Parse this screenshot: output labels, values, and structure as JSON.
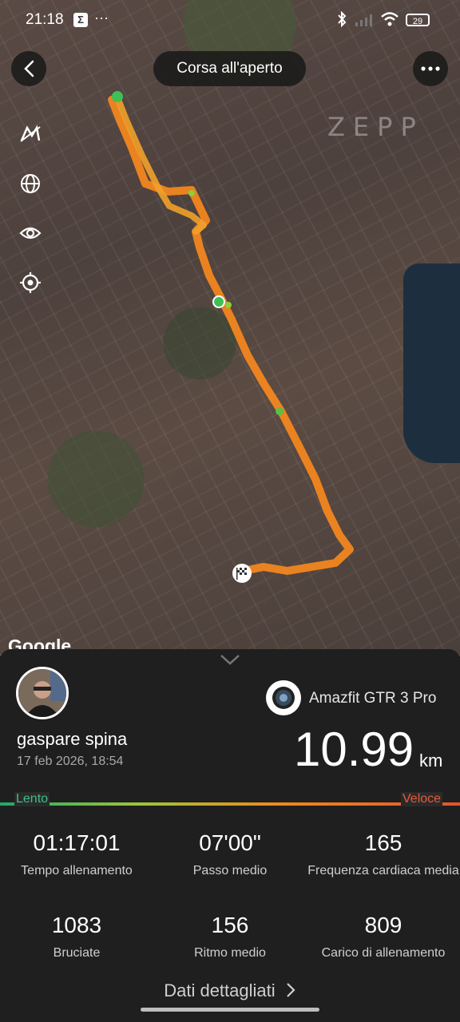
{
  "status_bar": {
    "time": "21:18",
    "sigma": "Σ",
    "more": "···",
    "battery": "29"
  },
  "header": {
    "title": "Corsa all'aperto"
  },
  "map": {
    "brand": "ZEPP",
    "attribution": "Google"
  },
  "profile": {
    "name": "gaspare spina",
    "date": "17 feb 2026, 18:54"
  },
  "device": {
    "name": "Amazfit GTR 3 Pro"
  },
  "summary": {
    "distance": "10.99",
    "unit": "km"
  },
  "pace_scale": {
    "slow_label": "Lento",
    "fast_label": "Veloce"
  },
  "stats": [
    {
      "value": "01:17:01",
      "label": "Tempo allenamento"
    },
    {
      "value": "07'00\"",
      "label": "Passo medio"
    },
    {
      "value": "165",
      "label": "Frequenza cardiaca media"
    },
    {
      "value": "1083",
      "label": "Bruciate"
    },
    {
      "value": "156",
      "label": "Ritmo medio"
    },
    {
      "value": "809",
      "label": "Carico di allenamento"
    }
  ],
  "footer": {
    "details_label": "Dati dettagliati"
  },
  "colors": {
    "route": "#f2861f",
    "slow": "#3cc28a",
    "fast": "#e85a3a",
    "panel": "#1f1f1f"
  }
}
